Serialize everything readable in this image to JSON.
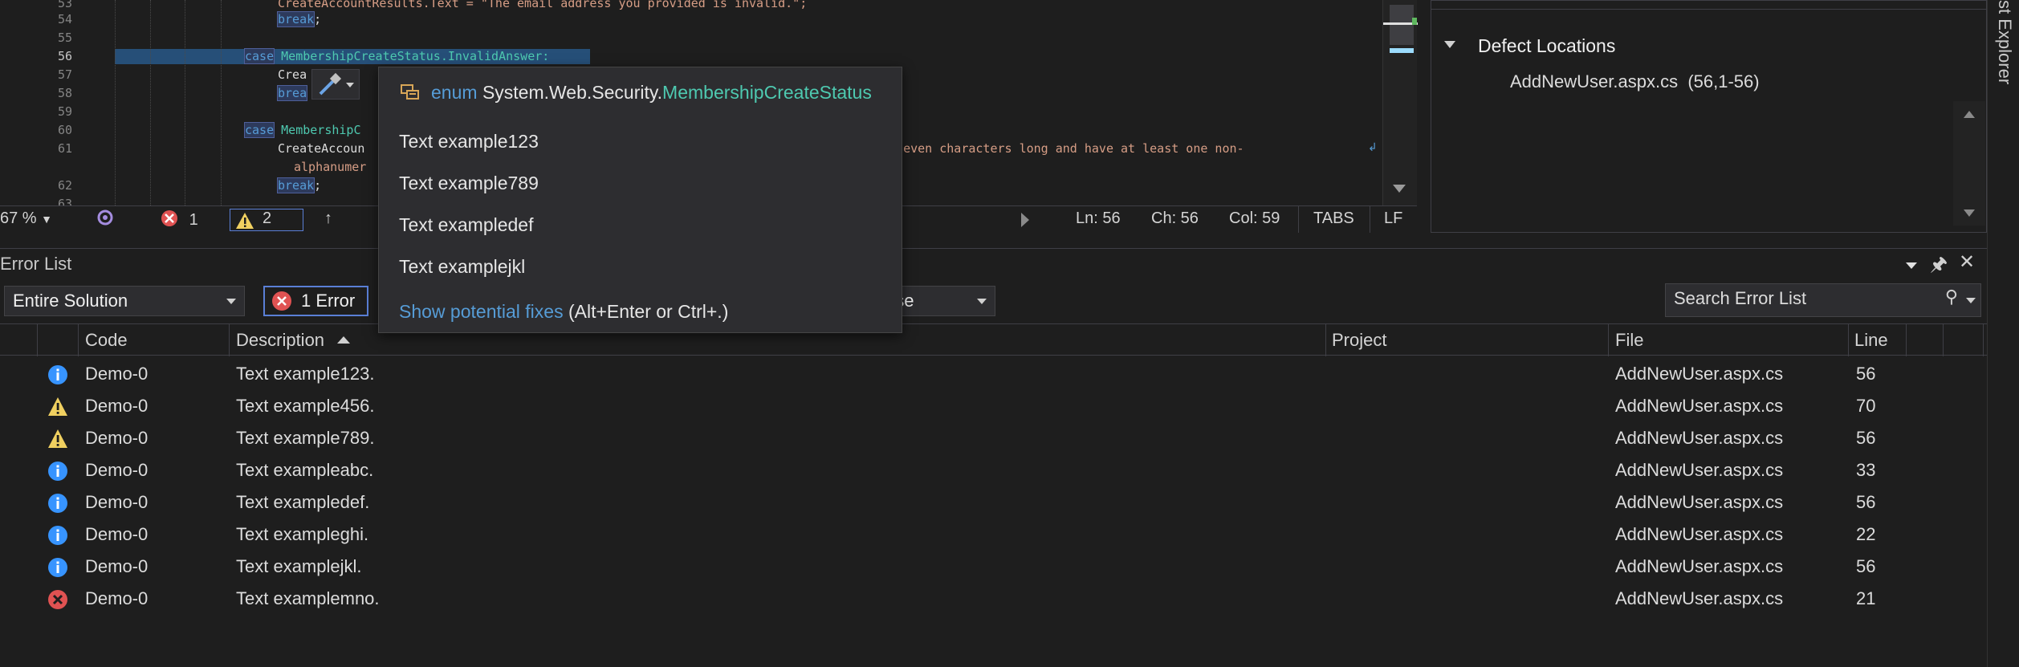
{
  "editor": {
    "lines": [
      {
        "num": "53",
        "text": "CreateAccountResults.Text = \"The email address you provided is invalid.\";"
      },
      {
        "num": "54",
        "keyword": "break",
        "rest": ";"
      },
      {
        "num": "55",
        "text": ""
      },
      {
        "num": "56",
        "keyword": "case",
        "rest": " MembershipCreateStatus.InvalidAnswer:"
      },
      {
        "num": "57",
        "text": "Crea"
      },
      {
        "num": "58",
        "keyword": "brea"
      },
      {
        "num": "59",
        "text": ""
      },
      {
        "num": "60",
        "keyword": "case",
        "rest": " MembershipC"
      },
      {
        "num": "61",
        "text": "CreateAccoun",
        "tail": "e seven characters long and have at least one non-"
      },
      {
        "num": "",
        "text": "alphanumer"
      },
      {
        "num": "62",
        "keyword": "break",
        "rest": ";"
      },
      {
        "num": "63",
        "text": ""
      }
    ]
  },
  "status_bar": {
    "zoom": "67 %",
    "errors_count": "1",
    "warnings_count": "2",
    "ln": "Ln: 56",
    "ch": "Ch: 56",
    "col": "Col: 59",
    "tabs": "TABS",
    "eol": "LF"
  },
  "right_pane": {
    "section_title": "Defect Locations",
    "location_file": "AddNewUser.aspx.cs",
    "location_range": "(56,1-56)",
    "vertical_tab": "st Explorer"
  },
  "popup": {
    "kind": "enum",
    "namespace": "System.Web.Security.",
    "type_name": "MembershipCreateStatus",
    "items": [
      "Text example123",
      "Text example789",
      "Text exampledef",
      "Text examplejkl"
    ],
    "fix_link": "Show potential fixes",
    "fix_shortcut": " (Alt+Enter or Ctrl+.)"
  },
  "error_list": {
    "title": "Error List",
    "scope": "Entire Solution",
    "errors_filter": "1 Error",
    "build_filter": "nse",
    "search_placeholder": "Search Error List",
    "columns": {
      "code": "Code",
      "description": "Description",
      "project": "Project",
      "file": "File",
      "line": "Line"
    },
    "rows": [
      {
        "severity": "info",
        "code": "Demo-0",
        "description": "Text example123.",
        "file": "AddNewUser.aspx.cs",
        "line": "56"
      },
      {
        "severity": "warning",
        "code": "Demo-0",
        "description": "Text example456.",
        "file": "AddNewUser.aspx.cs",
        "line": "70"
      },
      {
        "severity": "warning",
        "code": "Demo-0",
        "description": "Text example789.",
        "file": "AddNewUser.aspx.cs",
        "line": "56"
      },
      {
        "severity": "info",
        "code": "Demo-0",
        "description": "Text exampleabc.",
        "file": "AddNewUser.aspx.cs",
        "line": "33"
      },
      {
        "severity": "info",
        "code": "Demo-0",
        "description": "Text exampledef.",
        "file": "AddNewUser.aspx.cs",
        "line": "56"
      },
      {
        "severity": "info",
        "code": "Demo-0",
        "description": "Text exampleghi.",
        "file": "AddNewUser.aspx.cs",
        "line": "22"
      },
      {
        "severity": "info",
        "code": "Demo-0",
        "description": "Text examplejkl.",
        "file": "AddNewUser.aspx.cs",
        "line": "56"
      },
      {
        "severity": "error",
        "code": "Demo-0",
        "description": "Text examplemno.",
        "file": "AddNewUser.aspx.cs",
        "line": "21"
      }
    ]
  },
  "colors": {
    "info": "#3794ff",
    "warning": "#f0d060",
    "error": "#e05252",
    "selection": "#264f78"
  }
}
